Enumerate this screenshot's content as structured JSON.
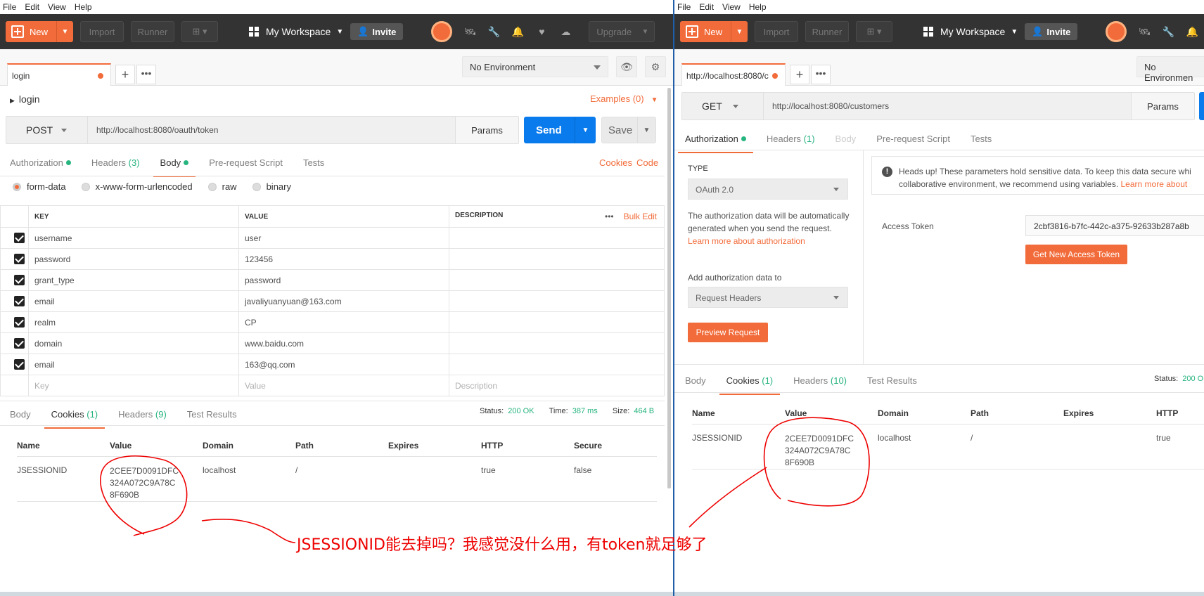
{
  "menu": [
    "File",
    "Edit",
    "View",
    "Help"
  ],
  "header": {
    "new_label": "New",
    "import_label": "Import",
    "runner_label": "Runner",
    "workspace_label": "My Workspace",
    "invite_label": "Invite",
    "upgrade_label": "Upgrade"
  },
  "left": {
    "tab_title": "login",
    "environment": "No Environment",
    "request_name": "login",
    "examples": "Examples (0)",
    "method": "POST",
    "url": "http://localhost:8080/oauth/token",
    "params": "Params",
    "send": "Send",
    "save": "Save",
    "req_tabs": {
      "authorization": "Authorization",
      "headers": "Headers",
      "headers_count": "(3)",
      "body": "Body",
      "prerequest": "Pre-request Script",
      "tests": "Tests"
    },
    "cookies_link": "Cookies",
    "code_link": "Code",
    "body_types": [
      "form-data",
      "x-www-form-urlencoded",
      "raw",
      "binary"
    ],
    "table_headers": {
      "key": "KEY",
      "value": "VALUE",
      "description": "DESCRIPTION",
      "bulk_edit": "Bulk Edit"
    },
    "rows": [
      {
        "key": "username",
        "value": "user"
      },
      {
        "key": "password",
        "value": "123456"
      },
      {
        "key": "grant_type",
        "value": "password"
      },
      {
        "key": "email",
        "value": "javaliyuanyuan@163.com"
      },
      {
        "key": "realm",
        "value": "CP"
      },
      {
        "key": "domain",
        "value": "www.baidu.com"
      },
      {
        "key": "email",
        "value": "163@qq.com"
      }
    ],
    "placeholders": {
      "key": "Key",
      "value": "Value",
      "description": "Description"
    },
    "resp_tabs": {
      "body": "Body",
      "cookies": "Cookies",
      "cookies_count": "(1)",
      "headers": "Headers",
      "headers_count": "(9)",
      "tests": "Test Results"
    },
    "status": {
      "status_label": "Status:",
      "status_value": "200 OK",
      "time_label": "Time:",
      "time_value": "387 ms",
      "size_label": "Size:",
      "size_value": "464 B"
    },
    "cookie_headers": [
      "Name",
      "Value",
      "Domain",
      "Path",
      "Expires",
      "HTTP",
      "Secure"
    ],
    "cookie": {
      "name": "JSESSIONID",
      "value": "2CEE7D0091DFC324A072C9A78C8F690B",
      "domain": "localhost",
      "path": "/",
      "expires": "",
      "http": "true",
      "secure": "false"
    }
  },
  "right": {
    "tab_title": "http://localhost:8080/c",
    "environment": "No Environmen",
    "method": "GET",
    "url": "http://localhost:8080/customers",
    "params": "Params",
    "req_tabs": {
      "authorization": "Authorization",
      "headers": "Headers",
      "headers_count": "(1)",
      "body": "Body",
      "prerequest": "Pre-request Script",
      "tests": "Tests"
    },
    "type_label": "TYPE",
    "type_value": "OAuth 2.0",
    "desc_text": "The authorization data will be automatically generated when you send the request.",
    "desc_link": "Learn more about authorization",
    "add_to_label": "Add authorization data to",
    "add_to_value": "Request Headers",
    "preview_btn": "Preview Request",
    "headsup_text": "Heads up! These parameters hold sensitive data. To keep this data secure whi collaborative environment, we recommend using variables.",
    "headsup_link": "Learn more about",
    "access_token_label": "Access Token",
    "access_token_value": "2cbf3816-b7fc-442c-a375-92633b287a8b",
    "get_token_btn": "Get New Access Token",
    "resp_tabs": {
      "body": "Body",
      "cookies": "Cookies",
      "cookies_count": "(1)",
      "headers": "Headers",
      "headers_count": "(10)",
      "tests": "Test Results"
    },
    "status": {
      "status_label": "Status:",
      "status_value": "200 O"
    },
    "cookie_headers": [
      "Name",
      "Value",
      "Domain",
      "Path",
      "Expires",
      "HTTP"
    ],
    "cookie": {
      "name": "JSESSIONID",
      "value": "2CEE7D0091DFC324A072C9A78C8F690B",
      "domain": "localhost",
      "path": "/",
      "expires": "",
      "http": "true"
    }
  },
  "annotation": "JSESSIONID能去掉吗？我感觉没什么用，有token就足够了",
  "colors": {
    "accent": "#f26b3a",
    "send": "#097bed",
    "ok": "#26b47f",
    "annotation": "#e00000",
    "header": "#333333"
  }
}
